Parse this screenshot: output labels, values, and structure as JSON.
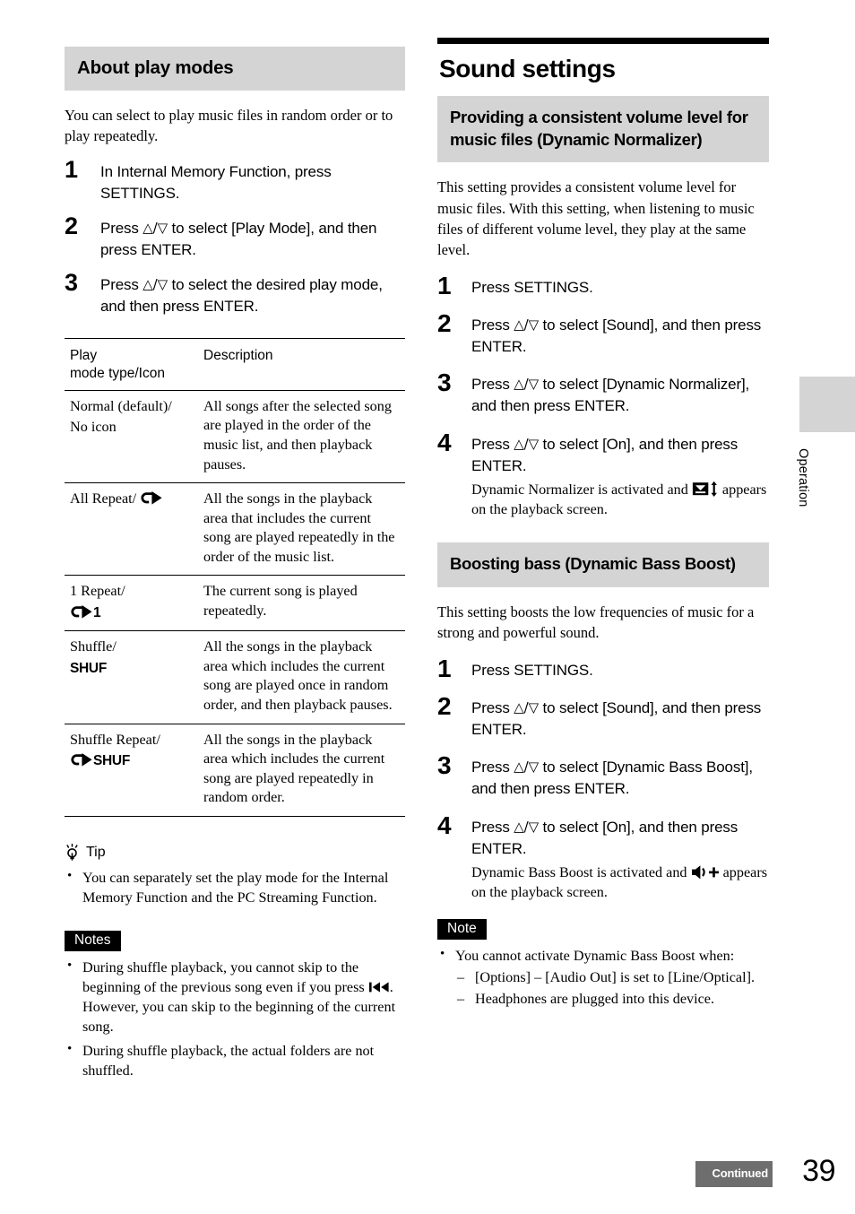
{
  "left_column": {
    "section_heading": "About play modes",
    "intro": "You can select to play music files in random order or to play repeatedly.",
    "steps": [
      {
        "num": "1",
        "text": "In Internal Memory Function, press SETTINGS."
      },
      {
        "num": "2",
        "text_before": "Press ",
        "text_after": " to select [Play Mode], and then press ENTER.",
        "arrows": "△/▽"
      },
      {
        "num": "3",
        "text_before": "Press ",
        "text_after": " to select the desired play mode, and then press ENTER.",
        "arrows": "△/▽"
      }
    ],
    "table": {
      "headers": [
        "Play\nmode type/Icon",
        "Description"
      ],
      "header_line1": "Play",
      "header_line2": "mode type/Icon",
      "header_desc": "Description",
      "rows": [
        {
          "type": "Normal (default)/",
          "type_line2": "No icon",
          "icon": "none",
          "description": "All songs after the selected song are played in the order of the music list, and then playback pauses."
        },
        {
          "type": "All Repeat/",
          "icon": "repeat-loop-icon",
          "description": "All the songs in the playback area that includes the current song are played repeatedly in the order of the music list."
        },
        {
          "type": "1 Repeat/",
          "icon": "repeat-one-icon",
          "icon_label": "1",
          "description": "The current song is played repeatedly."
        },
        {
          "type": "Shuffle/",
          "icon": "shuffle-icon",
          "icon_label": "SHUF",
          "description": "All the songs in the playback area which includes the current song are played once in random order, and then playback pauses."
        },
        {
          "type": "Shuffle Repeat/",
          "icon": "shuffle-repeat-icon",
          "icon_label": "SHUF",
          "description": "All the songs in the playback area which includes the current song are played repeatedly in random order."
        }
      ]
    },
    "tip": {
      "label": "Tip",
      "icon": "lightbulb-icon",
      "bullets": [
        "You can separately set the play mode for the Internal Memory Function and the PC Streaming Function."
      ]
    },
    "notes": {
      "badge": "Notes",
      "bullet1_part1": "During shuffle playback, you cannot skip to the beginning of the previous song even if you press ",
      "bullet1_icon": "previous-track-icon",
      "bullet1_part2": ". However, you can skip to the beginning of the current song.",
      "bullet2": "During shuffle playback, the actual folders are not shuffled."
    }
  },
  "right_column": {
    "title": "Sound settings",
    "section1": {
      "heading": "Providing a consistent volume level for music files (Dynamic Normalizer)",
      "intro": "This setting provides a consistent volume level for music files. With this setting, when listening to music files of different volume level, they play at the same level.",
      "steps": [
        {
          "num": "1",
          "text": "Press SETTINGS."
        },
        {
          "num": "2",
          "text_before": "Press ",
          "text_after": " to select [Sound], and then press ENTER.",
          "arrows": "△/▽"
        },
        {
          "num": "3",
          "text_before": "Press ",
          "text_after": " to select [Dynamic Normalizer], and then press ENTER.",
          "arrows": "△/▽"
        },
        {
          "num": "4",
          "text_before": "Press ",
          "text_after": " to select [On], and then press ENTER.",
          "arrows": "△/▽",
          "note_part1": "Dynamic Normalizer is activated and ",
          "note_icon": "dynamic-normalizer-icon",
          "note_part2": " appears on the playback screen."
        }
      ]
    },
    "section2": {
      "heading": "Boosting bass (Dynamic Bass Boost)",
      "intro": "This setting boosts the low frequencies of music for a strong and powerful sound.",
      "steps": [
        {
          "num": "1",
          "text": "Press SETTINGS."
        },
        {
          "num": "2",
          "text_before": "Press ",
          "text_after": " to select [Sound], and then press ENTER.",
          "arrows": "△/▽"
        },
        {
          "num": "3",
          "text_before": "Press ",
          "text_after": " to select [Dynamic Bass Boost], and then press ENTER.",
          "arrows": "△/▽"
        },
        {
          "num": "4",
          "text_before": "Press ",
          "text_after": " to select [On], and then press ENTER.",
          "arrows": "△/▽",
          "note_part1": "Dynamic Bass Boost is activated and ",
          "note_icon": "dynamic-bass-boost-icon",
          "note_part2": " appears on the playback screen."
        }
      ]
    },
    "note": {
      "badge": "Note",
      "bullet": "You cannot activate Dynamic Bass Boost when:",
      "sub_items": [
        "[Options] – [Audio Out] is set to [Line/Optical].",
        "Headphones are plugged into this device."
      ]
    }
  },
  "side_tab": {
    "label": "Operation"
  },
  "footer": {
    "continued": "Continued",
    "page_number": "39"
  },
  "colors": {
    "band_gray": "#d4d4d4",
    "footer_gray": "#6e6e6e",
    "black": "#000000"
  }
}
